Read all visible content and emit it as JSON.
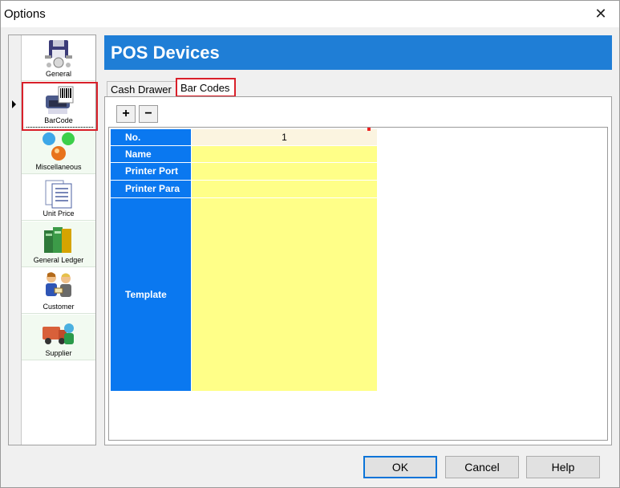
{
  "window": {
    "title": "Options",
    "close_glyph": "✕"
  },
  "nav": {
    "items": [
      {
        "label": "General",
        "icon": "floppy-robot-icon"
      },
      {
        "label": "BarCode",
        "icon": "barcode-printer-icon"
      },
      {
        "label": "Miscellaneous",
        "icon": "globes-icon"
      },
      {
        "label": "Unit Price",
        "icon": "documents-icon"
      },
      {
        "label": "General Ledger",
        "icon": "ledger-books-icon"
      },
      {
        "label": "Customer",
        "icon": "customer-people-icon"
      },
      {
        "label": "Supplier",
        "icon": "supplier-truck-icon"
      }
    ],
    "selected": "BarCode"
  },
  "banner": {
    "title": "POS Devices"
  },
  "tabs": [
    {
      "label": "Cash Drawer"
    },
    {
      "label": "Bar Codes"
    }
  ],
  "toolbar": {
    "add_label": "+",
    "remove_label": "−"
  },
  "grid": {
    "rows": [
      {
        "key": "No.",
        "value": "1"
      },
      {
        "key": "Name",
        "value": ""
      },
      {
        "key": "Printer Port",
        "value": ""
      },
      {
        "key": "Printer Para",
        "value": ""
      },
      {
        "key": "Template",
        "value": ""
      }
    ]
  },
  "buttons": {
    "ok": "OK",
    "cancel": "Cancel",
    "help": "Help"
  },
  "colors": {
    "banner": "#1f7ed6",
    "key_cell": "#0a78f0",
    "value_cell": "#ffff88",
    "highlight": "#d9202a"
  }
}
